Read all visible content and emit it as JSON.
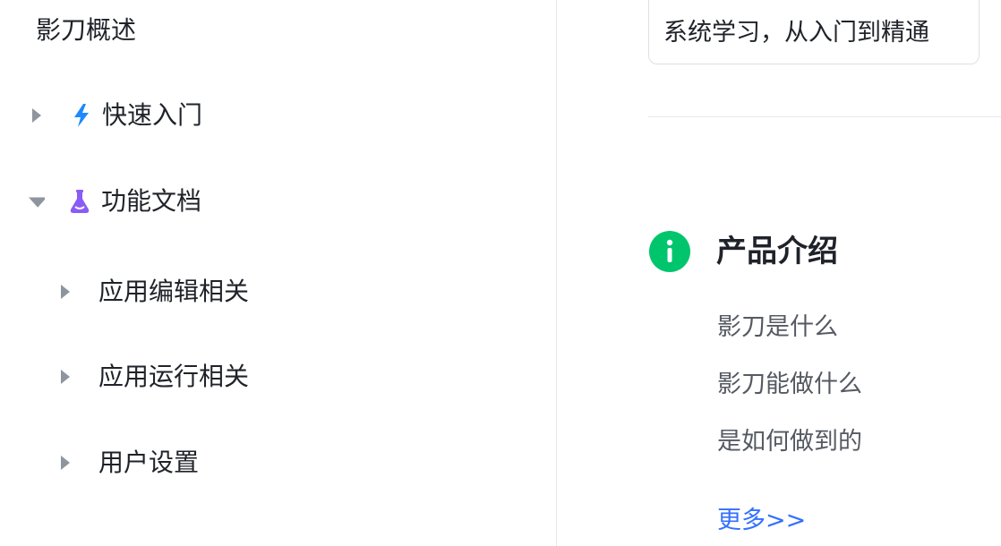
{
  "sidebar": {
    "top_item": "影刀概述",
    "items": [
      {
        "label": "快速入门",
        "expanded": false,
        "icon": "lightning-icon"
      },
      {
        "label": "功能文档",
        "expanded": true,
        "icon": "flask-icon",
        "children": [
          {
            "label": "应用编辑相关"
          },
          {
            "label": "应用运行相关"
          },
          {
            "label": "用户设置"
          }
        ]
      }
    ]
  },
  "main": {
    "card_text": "系统学习，从入门到精通",
    "section": {
      "title": "产品介绍",
      "icon": "info-icon",
      "links": [
        "影刀是什么",
        "影刀能做什么",
        "是如何做到的"
      ],
      "more": "更多>>"
    }
  },
  "colors": {
    "accent": "#3370ff",
    "info_green": "#00c56c",
    "flask_purple": "#8a5cf5",
    "lightning_blue": "#1e88ff",
    "caret_gray": "#8f959e"
  }
}
